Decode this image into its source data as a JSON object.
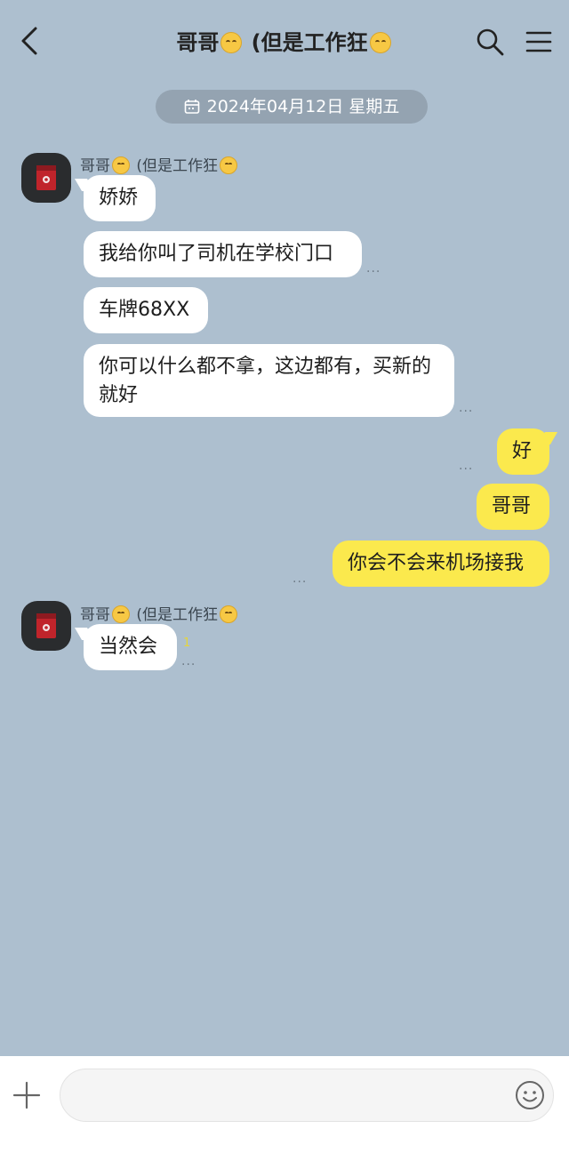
{
  "header": {
    "name_prefix": "哥哥",
    "name_suffix": " (但是工作狂",
    "back_icon": "chevron-left-icon",
    "search_icon": "search-icon",
    "menu_icon": "hamburger-menu-icon"
  },
  "date_separator": "2024年04月12日 星期五",
  "sender_name_prefix": "哥哥",
  "sender_name_suffix": " (但是工作狂",
  "messages": [
    {
      "from": "other",
      "text": "娇娇"
    },
    {
      "from": "other",
      "text": "我给你叫了司机在学校门口",
      "status": "..."
    },
    {
      "from": "other",
      "text": "车牌68XX"
    },
    {
      "from": "other",
      "text": "你可以什么都不拿，这边都有，买新的就好",
      "status": "..."
    },
    {
      "from": "me",
      "text": "好",
      "status": "..."
    },
    {
      "from": "me",
      "text": "哥哥"
    },
    {
      "from": "me",
      "text": "你会不会来机场接我",
      "status": "..."
    },
    {
      "from": "other",
      "text": "当然会",
      "unread": "1",
      "status": "..."
    }
  ],
  "input": {
    "placeholder": "",
    "value": ""
  },
  "colors": {
    "background": "#adbfcf",
    "my_bubble": "#fbe94d",
    "their_bubble": "#ffffff",
    "emoji": "#f7c844"
  }
}
